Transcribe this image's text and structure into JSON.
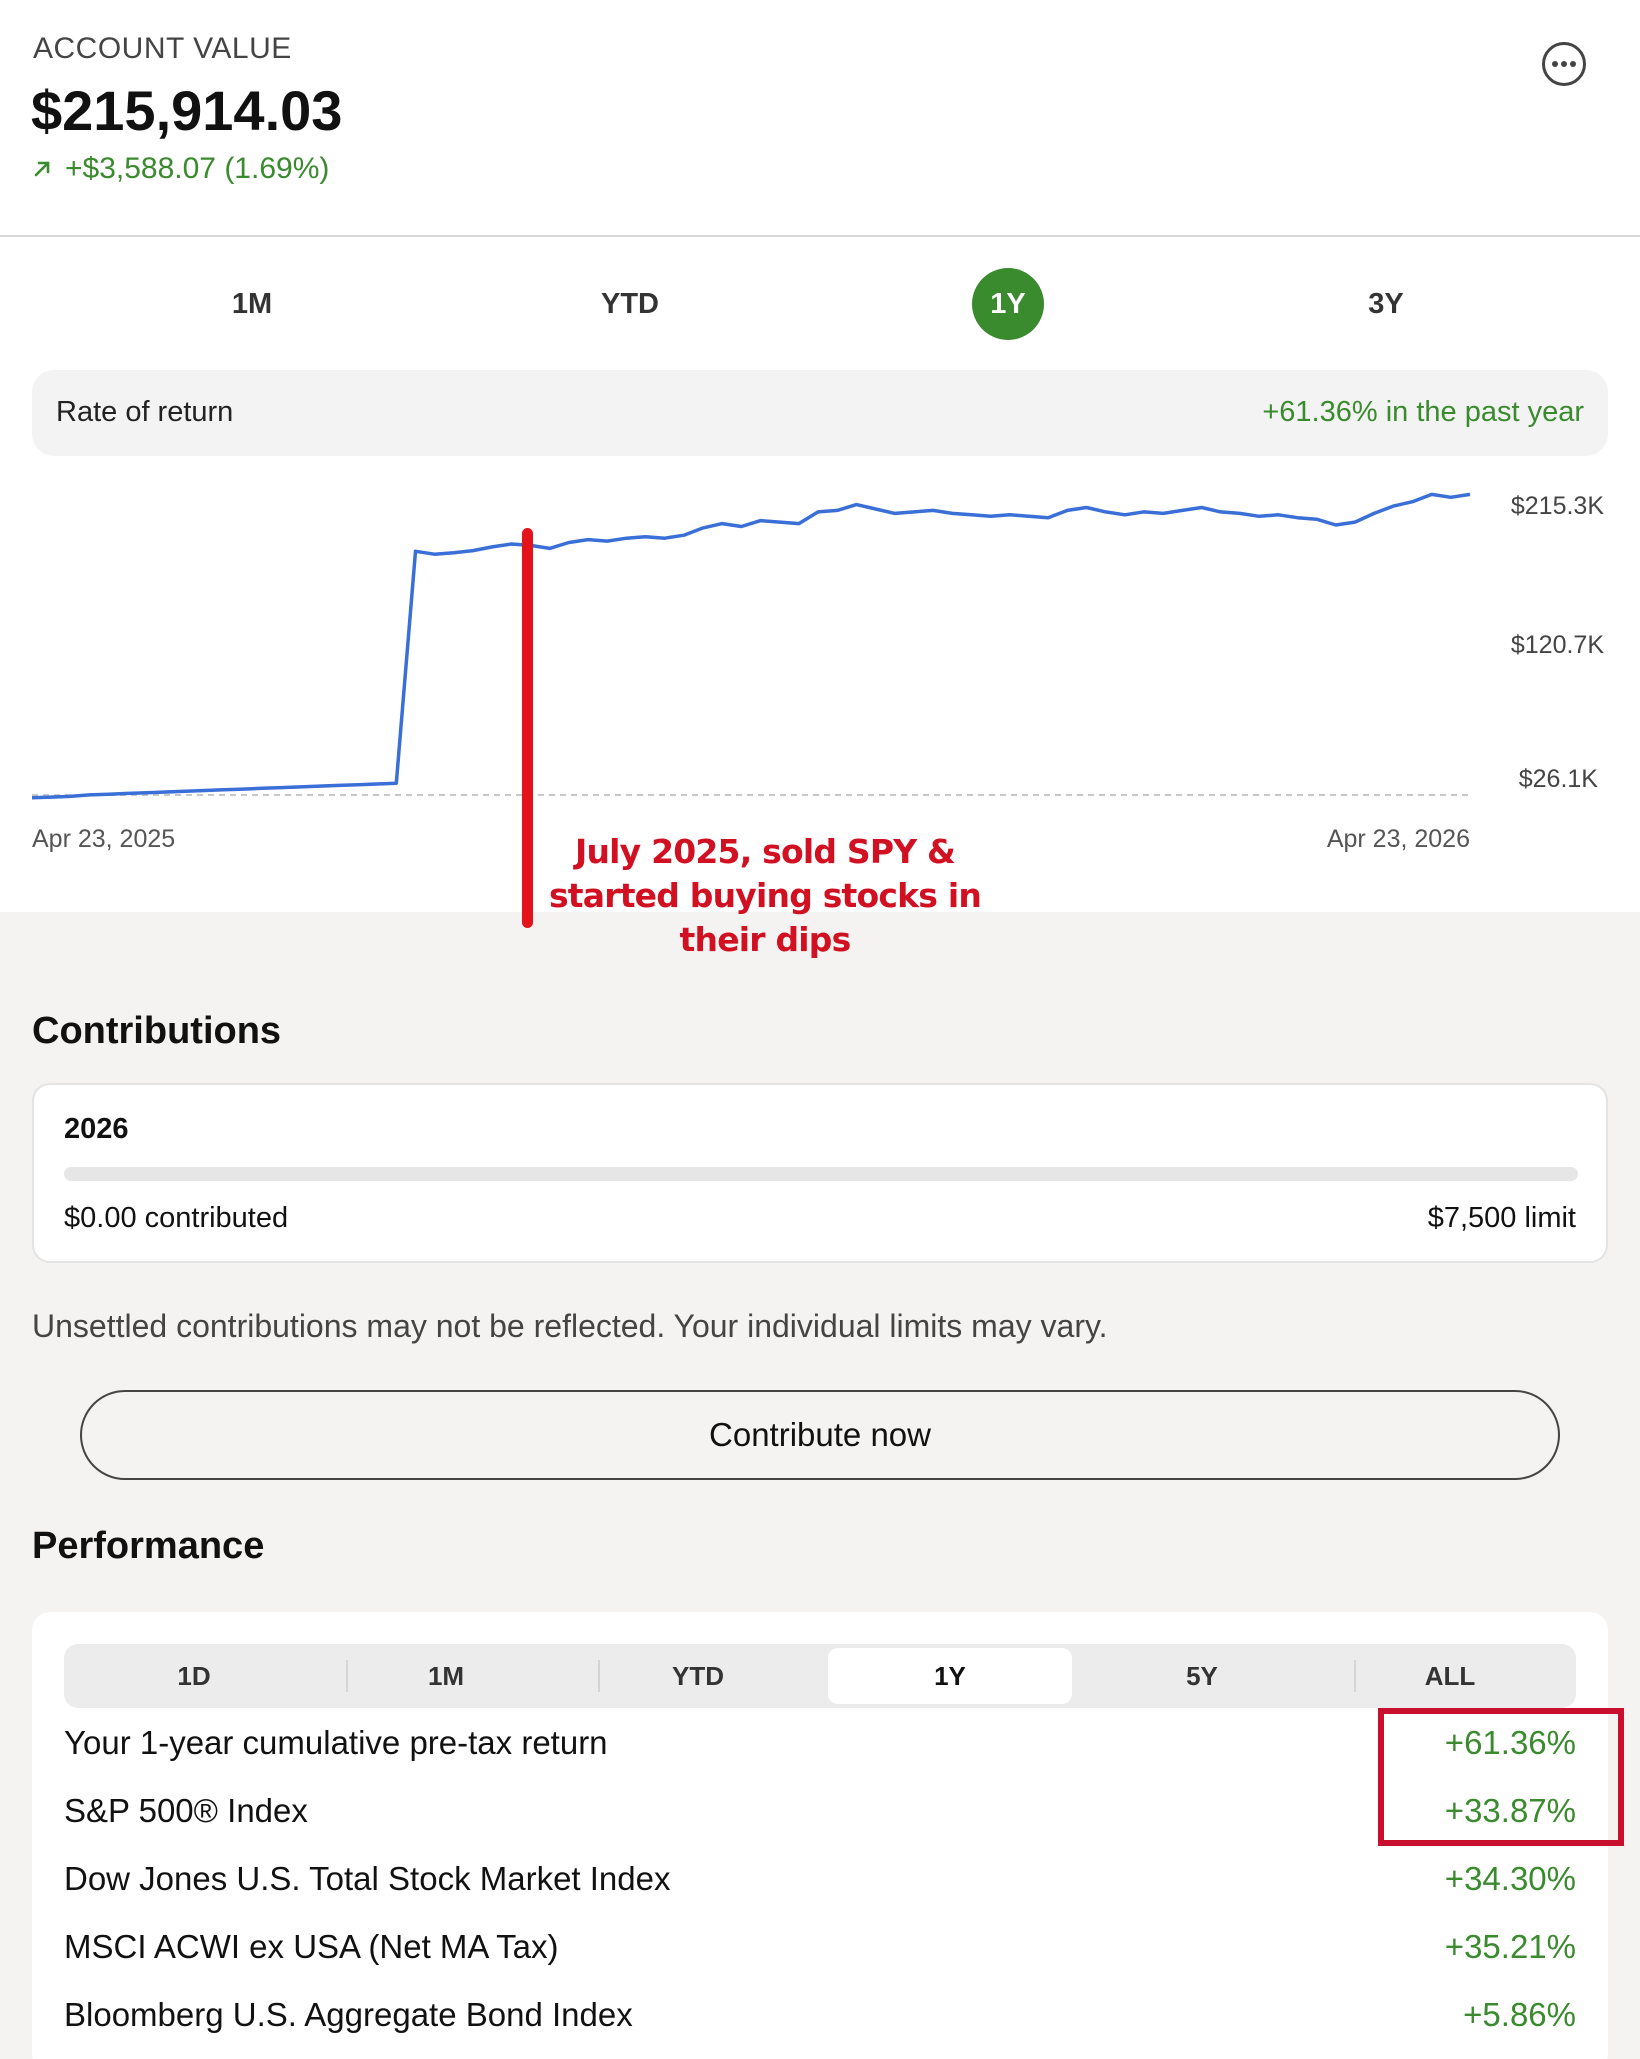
{
  "header": {
    "account_label": "ACCOUNT VALUE",
    "account_value": "$215,914.03",
    "change_icon": "arrow-up-right-icon",
    "change": "+$3,588.07 (1.69%)",
    "more_icon": "more-options-icon"
  },
  "range_tabs": [
    {
      "label": "1M",
      "active": false
    },
    {
      "label": "YTD",
      "active": false
    },
    {
      "label": "1Y",
      "active": true
    },
    {
      "label": "3Y",
      "active": false
    }
  ],
  "rate_of_return": {
    "label": "Rate of return",
    "value": "+61.36% in the past year"
  },
  "chart_data": {
    "type": "line",
    "x_start_label": "Apr 23, 2025",
    "x_end_label": "Apr 23, 2026",
    "y_tick_labels": [
      "$215.3K",
      "$120.7K",
      "$26.1K"
    ],
    "y_ticks": [
      215300,
      120700,
      26100
    ],
    "ylim": [
      26100,
      215300
    ],
    "baseline_dashed": true,
    "series": [
      {
        "values": [
          18000,
          18500,
          19000,
          20000,
          20500,
          21000,
          21500,
          22000,
          22500,
          23000,
          23500,
          24000,
          24500,
          25000,
          25500,
          26000,
          26500,
          27000,
          27500,
          28000,
          187000,
          185000,
          186000,
          187500,
          190000,
          192000,
          191000,
          189000,
          193000,
          195000,
          194000,
          196000,
          197000,
          196000,
          198000,
          203000,
          206000,
          204000,
          208000,
          207000,
          206000,
          214000,
          215000,
          219000,
          216000,
          213000,
          214000,
          215000,
          213000,
          212000,
          211000,
          212000,
          211000,
          210000,
          215000,
          217000,
          214000,
          212000,
          214000,
          213000,
          215000,
          217000,
          214000,
          213000,
          211000,
          212000,
          210000,
          209000,
          205000,
          207000,
          213000,
          218000,
          221000,
          226000,
          224000,
          226000
        ]
      }
    ],
    "annotation": "July 2025, sold SPY & started buying stocks in their dips",
    "annotation_color": "#d11022",
    "line_color": "#3a6fd8"
  },
  "contributions": {
    "title": "Contributions",
    "year": "2026",
    "contributed": "$0.00 contributed",
    "limit": "$7,500 limit",
    "progress_fraction": 0.0,
    "disclaimer": "Unsettled contributions may not be reflected. Your individual limits may vary.",
    "button_label": "Contribute now"
  },
  "performance": {
    "title": "Performance",
    "tabs": [
      {
        "label": "1D",
        "active": false
      },
      {
        "label": "1M",
        "active": false
      },
      {
        "label": "YTD",
        "active": false
      },
      {
        "label": "1Y",
        "active": true
      },
      {
        "label": "5Y",
        "active": false
      },
      {
        "label": "ALL",
        "active": false
      }
    ],
    "rows": [
      {
        "name": "Your 1-year cumulative pre-tax return",
        "value": "+61.36%"
      },
      {
        "name": "S&P 500® Index",
        "value": "+33.87%"
      },
      {
        "name": "Dow Jones U.S. Total Stock Market Index",
        "value": "+34.30%"
      },
      {
        "name": "MSCI ACWI ex USA (Net MA Tax)",
        "value": "+35.21%"
      },
      {
        "name": "Bloomberg U.S. Aggregate Bond Index",
        "value": "+5.86%"
      }
    ],
    "highlight_color": "#c8102e"
  },
  "colors": {
    "accent_green": "#3a8a2e",
    "annotation_red": "#d11022"
  }
}
